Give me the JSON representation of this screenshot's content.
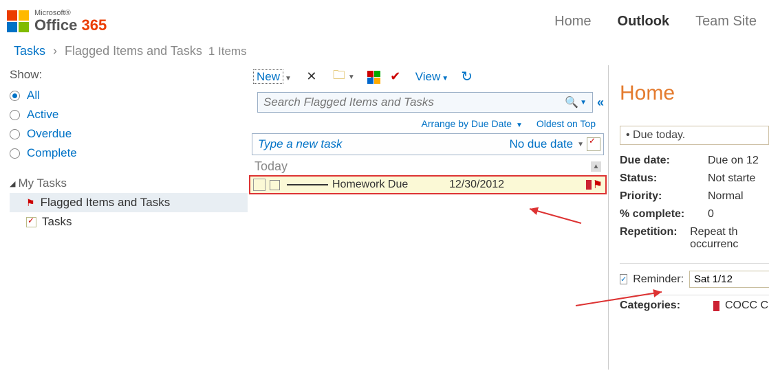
{
  "brand": {
    "small": "Microsoft®",
    "main": "Office",
    "accent": "365"
  },
  "nav": {
    "home": "Home",
    "outlook": "Outlook",
    "teamsite": "Team Site",
    "active": "outlook"
  },
  "breadcrumb": {
    "root": "Tasks",
    "current": "Flagged Items and Tasks",
    "count": "1 Items"
  },
  "left": {
    "show_label": "Show:",
    "filters": [
      "All",
      "Active",
      "Overdue",
      "Complete"
    ],
    "filter_selected": "All",
    "tree_header": "My Tasks",
    "tree_items": [
      "Flagged Items and Tasks",
      "Tasks"
    ],
    "tree_selected": "Flagged Items and Tasks"
  },
  "toolbar": {
    "new": "New",
    "view": "View"
  },
  "mid": {
    "search_placeholder": "Search Flagged Items and Tasks",
    "arrange_label": "Arrange by Due Date",
    "sort_label": "Oldest on Top",
    "new_task_placeholder": "Type a new task",
    "no_due": "No due date",
    "group_header": "Today",
    "task": {
      "title": "Homework Due",
      "date": "12/30/2012"
    }
  },
  "right": {
    "title": "Home",
    "due_banner": "• Due today.",
    "rows": {
      "due_date_k": "Due date:",
      "due_date_v": "Due on 12",
      "status_k": "Status:",
      "status_v": "Not starte",
      "priority_k": "Priority:",
      "priority_v": "Normal",
      "pct_k": "% complete:",
      "pct_v": "0",
      "rep_k": "Repetition:",
      "rep_v": "Repeat th occurrenc"
    },
    "reminder_label": "Reminder:",
    "reminder_value": "Sat 1/12",
    "categories_k": "Categories:",
    "categories_v": "COCC C"
  }
}
